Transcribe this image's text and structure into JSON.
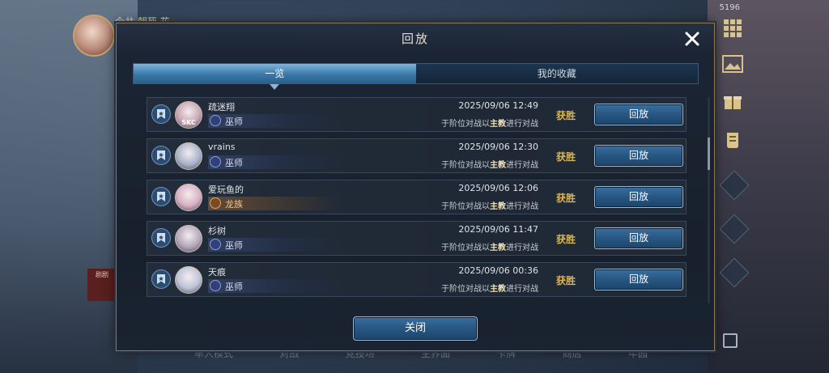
{
  "background": {
    "player_name": "今井 朝死 花",
    "counter": "5196",
    "left_tag": "剧剧",
    "nav_items": [
      "牟人模式",
      "对战",
      "竞技场",
      "主界面",
      "卡牌",
      "商店",
      "牢园"
    ]
  },
  "dialog": {
    "title": "回放",
    "tabs": [
      {
        "label": "一览",
        "active": true
      },
      {
        "label": "我的收藏",
        "active": false
      }
    ],
    "rows": [
      {
        "name": "疏迷翔",
        "avatar_label": "SKC",
        "class": "巫师",
        "class_type": "mage",
        "time": "2025/09/06  12:49",
        "desc_pre": "于阶位对战以",
        "desc_hl": "主教",
        "desc_post": "进行对战",
        "result": "获胜",
        "button": "回放",
        "avatar_color": "#c9a6b4"
      },
      {
        "name": "vrains",
        "avatar_label": "",
        "class": "巫师",
        "class_type": "mage",
        "time": "2025/09/06  12:30",
        "desc_pre": "于阶位对战以",
        "desc_hl": "主教",
        "desc_post": "进行对战",
        "result": "获胜",
        "button": "回放",
        "avatar_color": "#a8b4cc"
      },
      {
        "name": "爱玩鱼的",
        "avatar_label": "",
        "class": "龙族",
        "class_type": "dragon",
        "time": "2025/09/06  12:06",
        "desc_pre": "于阶位对战以",
        "desc_hl": "主教",
        "desc_post": "进行对战",
        "result": "获胜",
        "button": "回放",
        "avatar_color": "#d8b0c4"
      },
      {
        "name": "杉树",
        "avatar_label": "",
        "class": "巫师",
        "class_type": "mage",
        "time": "2025/09/06  11:47",
        "desc_pre": "于阶位对战以",
        "desc_hl": "主教",
        "desc_post": "进行对战",
        "result": "获胜",
        "button": "回放",
        "avatar_color": "#b4a8bc"
      },
      {
        "name": "天痕",
        "avatar_label": "",
        "class": "巫师",
        "class_type": "mage",
        "time": "2025/09/06  00:36",
        "desc_pre": "于阶位对战以",
        "desc_hl": "主教",
        "desc_post": "进行对战",
        "result": "获胜",
        "button": "回放",
        "avatar_color": "#bcc4d8"
      }
    ],
    "close_label": "关闭"
  },
  "colors": {
    "accent_blue": "#3b6f9e",
    "win_gold": "#d9b55a",
    "frame_gold": "#8e7a52"
  }
}
